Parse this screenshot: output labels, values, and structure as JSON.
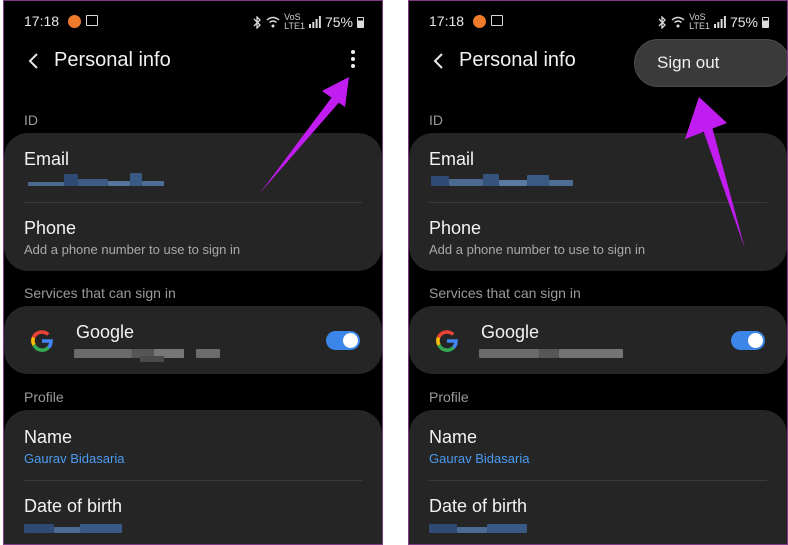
{
  "status": {
    "time": "17:18",
    "net_top": "VoS",
    "net_bottom": "LTE1",
    "battery": "75%"
  },
  "header": {
    "title": "Personal info"
  },
  "sections": {
    "id": "ID",
    "services": "Services that can sign in",
    "profile": "Profile"
  },
  "email": {
    "label": "Email"
  },
  "phone": {
    "label": "Phone",
    "hint": "Add a phone number to use to sign in"
  },
  "google": {
    "label": "Google",
    "toggle_on": true
  },
  "name": {
    "label": "Name",
    "value": "Gaurav Bidasaria"
  },
  "dob": {
    "label": "Date of birth"
  },
  "menu": {
    "sign_out": "Sign out"
  },
  "colors": {
    "background": "#000000",
    "card": "#252525",
    "link": "#4b9bf1",
    "toggle": "#3b86e8",
    "annotation_arrow": "#c11cf0"
  },
  "icons": [
    "back-arrow-icon",
    "more-options-icon",
    "google-logo-icon",
    "wifi-icon",
    "bluetooth-icon",
    "battery-icon"
  ]
}
